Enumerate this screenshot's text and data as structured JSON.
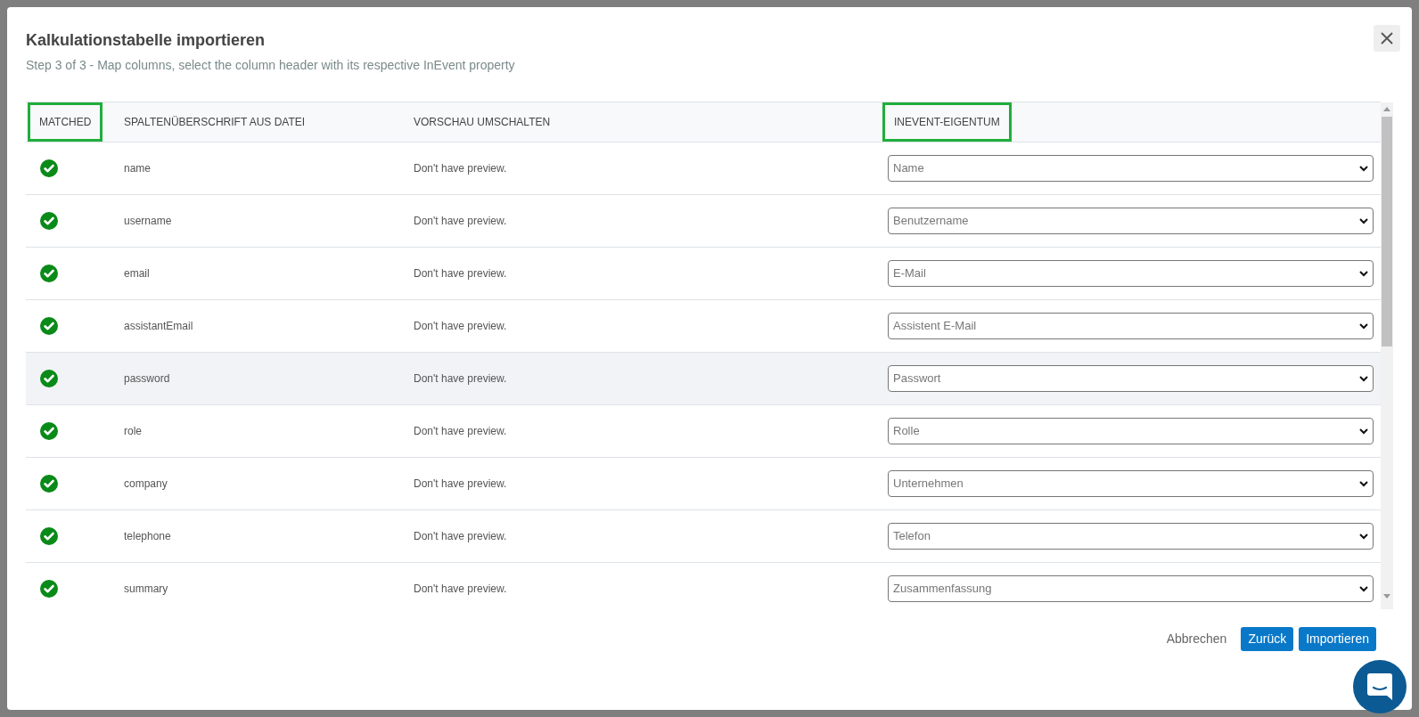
{
  "dialog": {
    "title": "Kalkulationstabelle importieren",
    "subtitle": "Step 3 of 3 - Map columns, select the column header with its respective InEvent property"
  },
  "table": {
    "columns": [
      {
        "label": "MATCHED",
        "outlined": true
      },
      {
        "label": "SPALTENÜBERSCHRIFT AUS DATEI",
        "outlined": false
      },
      {
        "label": "VORSCHAU UMSCHALTEN",
        "outlined": false
      },
      {
        "label": "INEVENT-EIGENTUM",
        "outlined": true
      }
    ],
    "rows": [
      {
        "matched": true,
        "header": "name",
        "preview": "Don't have preview.",
        "property": "Name",
        "highlighted": false
      },
      {
        "matched": true,
        "header": "username",
        "preview": "Don't have preview.",
        "property": "Benutzername",
        "highlighted": false
      },
      {
        "matched": true,
        "header": "email",
        "preview": "Don't have preview.",
        "property": "E-Mail",
        "highlighted": false
      },
      {
        "matched": true,
        "header": "assistantEmail",
        "preview": "Don't have preview.",
        "property": "Assistent E-Mail",
        "highlighted": false
      },
      {
        "matched": true,
        "header": "password",
        "preview": "Don't have preview.",
        "property": "Passwort",
        "highlighted": true
      },
      {
        "matched": true,
        "header": "role",
        "preview": "Don't have preview.",
        "property": "Rolle",
        "highlighted": false
      },
      {
        "matched": true,
        "header": "company",
        "preview": "Don't have preview.",
        "property": "Unternehmen",
        "highlighted": false
      },
      {
        "matched": true,
        "header": "telephone",
        "preview": "Don't have preview.",
        "property": "Telefon",
        "highlighted": false
      },
      {
        "matched": true,
        "header": "summary",
        "preview": "Don't have preview.",
        "property": "Zusammenfassung",
        "highlighted": false
      }
    ]
  },
  "buttons": [
    {
      "label": "Abbrechen",
      "kind": "link"
    },
    {
      "label": "Zurück",
      "kind": "primary"
    },
    {
      "label": "Importieren",
      "kind": "primary"
    }
  ]
}
